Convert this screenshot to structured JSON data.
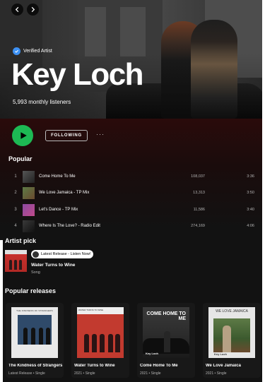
{
  "nav": {
    "back_icon": "chevron-left-icon",
    "forward_icon": "chevron-right-icon"
  },
  "artist": {
    "verified_label": "Verified Artist",
    "name": "Key Loch",
    "monthly_listeners": "5,993 monthly listeners"
  },
  "actions": {
    "follow_label": "FOLLOWING",
    "more_label": "···"
  },
  "popular": {
    "title": "Popular",
    "tracks": [
      {
        "num": "1",
        "name": "Come Home To Me",
        "plays": "108,037",
        "duration": "3:36"
      },
      {
        "num": "2",
        "name": "We Love Jamaica - TP Mix",
        "plays": "13,313",
        "duration": "3:50"
      },
      {
        "num": "3",
        "name": "Let's Dance - TP Mix",
        "plays": "11,586",
        "duration": "3:40"
      },
      {
        "num": "4",
        "name": "Where Is The Love? - Radio Edit",
        "plays": "274,169",
        "duration": "4:06"
      }
    ]
  },
  "artist_pick": {
    "title": "Artist pick",
    "tag": "Latest Release - Listen Now!",
    "item_title": "Water Turns to Wine",
    "item_type": "Song"
  },
  "popular_releases": {
    "title": "Popular releases",
    "items": [
      {
        "title": "The Kindness of Strangers",
        "subtitle": "Latest Release • Single",
        "cover_caption": "THE KINDNESS OF STRANGERS"
      },
      {
        "title": "Water Turns to Wine",
        "subtitle": "2021 • Single",
        "cover_caption": "WATER TURNS TO WINE"
      },
      {
        "title": "Come Home To Me",
        "subtitle": "2021 • Single",
        "cover_caption": "COME HOME TO ME",
        "cover_logo": "Key Loch"
      },
      {
        "title": "We Love Jamaica",
        "subtitle": "2021 • Single",
        "cover_caption": "WE LOVE JAMAICA",
        "cover_logo": "Key Loch"
      }
    ]
  },
  "colors": {
    "accent": "#1db954",
    "verified": "#3d91f4",
    "background": "#121212"
  }
}
